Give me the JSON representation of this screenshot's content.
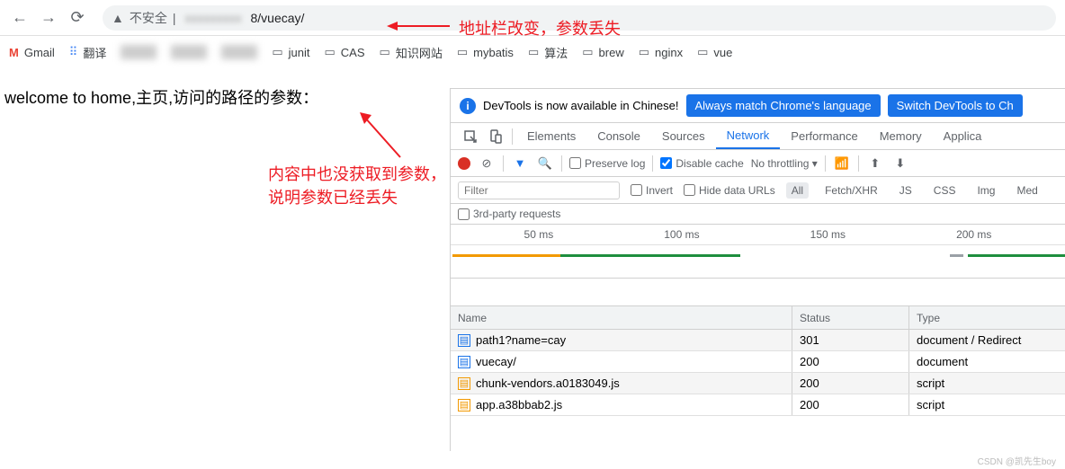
{
  "browser": {
    "security_text": "不安全",
    "url_suffix": "8/vuecay/"
  },
  "bookmarks": {
    "gmail": "Gmail",
    "translate": "翻译",
    "folders": [
      "junit",
      "CAS",
      "知识网站",
      "mybatis",
      "算法",
      "brew",
      "nginx",
      "vue"
    ]
  },
  "page_content": "welcome to home,主页,访问的路径的参数：",
  "annotations": {
    "addr": "地址栏改变，参数丢失",
    "content_lost_1": "内容中也没获取到参数，",
    "content_lost_2": "说明参数已经丢失",
    "param_lost": "参数丢失"
  },
  "devtools": {
    "banner_text": "DevTools is now available in Chinese!",
    "banner_btn1": "Always match Chrome's language",
    "banner_btn2": "Switch DevTools to Ch",
    "tabs": [
      "Elements",
      "Console",
      "Sources",
      "Network",
      "Performance",
      "Memory",
      "Applica"
    ],
    "active_tab": "Network",
    "preserve_log": "Preserve log",
    "disable_cache": "Disable cache",
    "throttling": "No throttling",
    "filter_placeholder": "Filter",
    "filter_options": {
      "invert": "Invert",
      "hide": "Hide data URLs"
    },
    "filter_chips": [
      "All",
      "Fetch/XHR",
      "JS",
      "CSS",
      "Img",
      "Med"
    ],
    "third_party": "3rd-party requests",
    "timeline_marks": [
      "50 ms",
      "100 ms",
      "150 ms",
      "200 ms"
    ],
    "table": {
      "headers": {
        "name": "Name",
        "status": "Status",
        "type": "Type"
      },
      "rows": [
        {
          "name": "path1?name=cay",
          "status": "301",
          "type": "document / Redirect",
          "icon": "doc"
        },
        {
          "name": "vuecay/",
          "status": "200",
          "type": "document",
          "icon": "doc"
        },
        {
          "name": "chunk-vendors.a0183049.js",
          "status": "200",
          "type": "script",
          "icon": "js"
        },
        {
          "name": "app.a38bbab2.js",
          "status": "200",
          "type": "script",
          "icon": "js"
        }
      ]
    }
  },
  "watermark": "CSDN @凯先生boy"
}
